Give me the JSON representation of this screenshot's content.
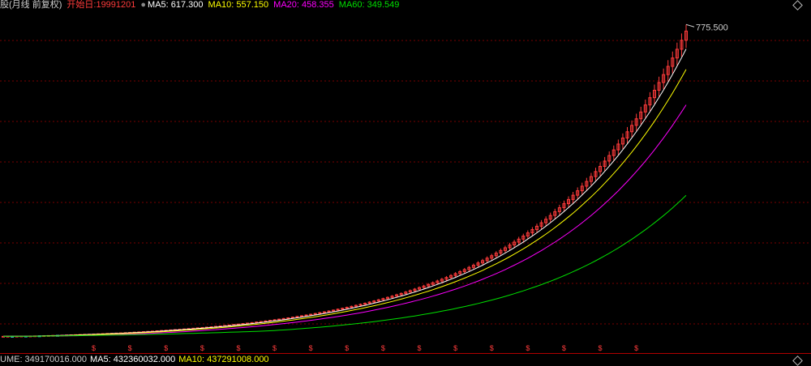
{
  "header": {
    "title_fragment": "股(月线 前复权)",
    "start_label": "开始日:19991201",
    "ma5": "MA5: 617.300",
    "ma10": "MA10: 557.150",
    "ma20": "MA20: 458.355",
    "ma60": "MA60: 349.549"
  },
  "volume_header": {
    "vol": "UME: 349170016.000",
    "ma5": "MA5: 432360032.000",
    "ma10": "MA10: 437291008.000"
  },
  "colors": {
    "up": "#ff3b3b",
    "down": "#54f0ff",
    "ma5": "#ffffff",
    "ma10": "#ffff00",
    "ma20": "#ff00ff",
    "ma60": "#00e000",
    "grid": "#7a0000",
    "text": "#cccccc"
  },
  "chart_data": {
    "type": "candlestick",
    "max_label": "775.500",
    "marker_glyph": "$",
    "dividend_markers": [
      5,
      7,
      9,
      11,
      13,
      15,
      17,
      19,
      21,
      23,
      25,
      27,
      29,
      31,
      33,
      35
    ],
    "ylim": [
      0,
      800
    ],
    "ohlc": [
      [
        5.0,
        5.6,
        4.8,
        5.3
      ],
      [
        5.3,
        5.8,
        5.1,
        5.5
      ],
      [
        5.5,
        6.0,
        5.2,
        5.4
      ],
      [
        5.4,
        5.9,
        5.2,
        5.7
      ],
      [
        5.7,
        6.2,
        5.5,
        6.0
      ],
      [
        6.0,
        6.4,
        5.7,
        5.8
      ],
      [
        5.8,
        6.3,
        5.6,
        6.1
      ],
      [
        6.1,
        6.7,
        5.9,
        6.5
      ],
      [
        6.5,
        7.0,
        6.2,
        6.4
      ],
      [
        6.4,
        7.1,
        6.3,
        6.9
      ],
      [
        6.9,
        7.4,
        6.6,
        7.2
      ],
      [
        7.2,
        7.8,
        7.0,
        7.6
      ],
      [
        7.6,
        8.1,
        7.3,
        7.5
      ],
      [
        7.5,
        8.3,
        7.4,
        8.1
      ],
      [
        8.1,
        8.8,
        7.9,
        8.6
      ],
      [
        8.6,
        9.2,
        8.3,
        8.9
      ],
      [
        8.9,
        9.6,
        8.7,
        9.3
      ],
      [
        9.3,
        10.1,
        9.1,
        9.8
      ],
      [
        9.8,
        10.5,
        9.4,
        10.2
      ],
      [
        10.2,
        11.0,
        9.9,
        10.6
      ],
      [
        10.6,
        11.4,
        10.3,
        11.0
      ],
      [
        11.0,
        11.9,
        10.7,
        11.5
      ],
      [
        11.5,
        12.3,
        11.1,
        11.9
      ],
      [
        11.9,
        12.8,
        11.6,
        12.4
      ],
      [
        12.4,
        13.2,
        12.0,
        12.8
      ],
      [
        12.8,
        13.7,
        12.5,
        13.3
      ],
      [
        13.3,
        14.2,
        12.9,
        13.8
      ],
      [
        13.8,
        14.8,
        13.4,
        14.3
      ],
      [
        14.3,
        15.3,
        13.9,
        14.9
      ],
      [
        14.9,
        16.0,
        14.5,
        15.6
      ],
      [
        15.6,
        16.6,
        15.1,
        16.2
      ],
      [
        16.2,
        17.3,
        15.8,
        16.9
      ],
      [
        16.9,
        18.0,
        16.4,
        17.5
      ],
      [
        17.5,
        18.7,
        17.0,
        18.3
      ],
      [
        18.3,
        19.5,
        17.8,
        19.0
      ],
      [
        19.0,
        20.3,
        18.5,
        19.7
      ],
      [
        19.7,
        20.9,
        19.2,
        20.4
      ],
      [
        20.4,
        21.8,
        19.9,
        21.2
      ],
      [
        21.2,
        22.6,
        20.7,
        22.0
      ],
      [
        22.0,
        23.3,
        21.4,
        22.7
      ],
      [
        22.7,
        24.2,
        22.1,
        23.5
      ],
      [
        23.5,
        25.0,
        22.9,
        24.4
      ],
      [
        24.4,
        26.0,
        23.8,
        25.3
      ],
      [
        25.3,
        27.0,
        24.6,
        26.2
      ],
      [
        26.2,
        27.9,
        25.5,
        27.1
      ],
      [
        27.1,
        28.9,
        26.4,
        28.0
      ],
      [
        28.0,
        29.8,
        27.3,
        29.0
      ],
      [
        29.0,
        30.9,
        28.3,
        30.0
      ],
      [
        30.0,
        31.9,
        29.2,
        31.0
      ],
      [
        31.0,
        33.0,
        30.2,
        32.1
      ],
      [
        32.1,
        34.2,
        31.3,
        33.2
      ],
      [
        33.2,
        35.3,
        32.3,
        34.4
      ],
      [
        34.4,
        36.6,
        33.5,
        35.5
      ],
      [
        35.5,
        37.8,
        34.6,
        36.8
      ],
      [
        36.8,
        39.0,
        35.8,
        38.0
      ],
      [
        38.0,
        40.4,
        37.0,
        39.2
      ],
      [
        39.2,
        41.7,
        38.2,
        40.6
      ],
      [
        40.6,
        43.1,
        39.5,
        41.9
      ],
      [
        41.9,
        44.5,
        40.8,
        43.3
      ],
      [
        43.3,
        46.0,
        42.2,
        44.8
      ],
      [
        44.8,
        47.5,
        43.6,
        46.2
      ],
      [
        46.2,
        49.0,
        45.0,
        47.8
      ],
      [
        47.8,
        50.6,
        46.5,
        49.3
      ],
      [
        49.3,
        52.2,
        48.0,
        51.0
      ],
      [
        51.0,
        54.0,
        49.6,
        52.6
      ],
      [
        52.6,
        55.7,
        51.2,
        54.3
      ],
      [
        54.3,
        57.5,
        52.9,
        56.1
      ],
      [
        56.1,
        59.3,
        54.6,
        57.9
      ],
      [
        57.9,
        61.2,
        56.4,
        59.8
      ],
      [
        59.8,
        63.2,
        58.2,
        61.7
      ],
      [
        61.7,
        65.3,
        60.1,
        63.7
      ],
      [
        63.7,
        67.3,
        62.0,
        65.7
      ],
      [
        65.7,
        69.5,
        64.0,
        67.8
      ],
      [
        67.8,
        71.7,
        66.1,
        70.0
      ],
      [
        70.0,
        74.0,
        68.1,
        72.3
      ],
      [
        72.3,
        76.3,
        70.4,
        74.5
      ],
      [
        74.5,
        78.7,
        72.6,
        76.9
      ],
      [
        76.9,
        81.2,
        74.9,
        79.3
      ],
      [
        79.3,
        83.8,
        77.2,
        81.8
      ],
      [
        81.8,
        86.4,
        79.7,
        84.4
      ],
      [
        84.4,
        89.1,
        82.2,
        87.0
      ],
      [
        87.0,
        91.9,
        84.8,
        89.8
      ],
      [
        89.8,
        94.7,
        87.5,
        92.6
      ],
      [
        92.6,
        97.7,
        90.2,
        95.5
      ],
      [
        95.5,
        100.7,
        93.0,
        98.4
      ],
      [
        98.4,
        103.8,
        95.9,
        101.5
      ],
      [
        101.5,
        107.1,
        98.9,
        104.6
      ],
      [
        104.6,
        110.4,
        101.9,
        107.9
      ],
      [
        107.9,
        113.8,
        105.1,
        111.2
      ],
      [
        111.2,
        117.3,
        108.4,
        114.7
      ],
      [
        114.7,
        121.0,
        111.7,
        118.2
      ],
      [
        118.2,
        124.7,
        115.2,
        121.9
      ],
      [
        121.9,
        128.6,
        118.7,
        125.6
      ],
      [
        125.6,
        132.5,
        122.4,
        129.5
      ],
      [
        129.5,
        136.6,
        126.2,
        133.5
      ],
      [
        133.5,
        140.8,
        130.1,
        137.6
      ],
      [
        137.6,
        145.2,
        134.1,
        141.9
      ],
      [
        141.9,
        149.6,
        138.2,
        146.2
      ],
      [
        146.2,
        154.2,
        142.5,
        150.7
      ],
      [
        150.7,
        158.9,
        146.9,
        155.4
      ],
      [
        155.4,
        163.9,
        151.4,
        160.2
      ],
      [
        160.2,
        168.9,
        156.1,
        165.1
      ],
      [
        165.1,
        174.1,
        160.9,
        170.2
      ],
      [
        170.2,
        179.5,
        165.9,
        175.5
      ],
      [
        175.5,
        185.1,
        171.0,
        180.9
      ],
      [
        180.9,
        190.8,
        176.3,
        186.5
      ],
      [
        186.5,
        196.7,
        181.7,
        192.3
      ],
      [
        192.3,
        202.8,
        187.4,
        198.3
      ],
      [
        198.3,
        209.1,
        193.2,
        204.4
      ],
      [
        204.4,
        215.6,
        199.2,
        210.7
      ],
      [
        210.7,
        222.2,
        205.3,
        217.3
      ],
      [
        217.3,
        229.1,
        211.7,
        224.0
      ],
      [
        224.0,
        236.2,
        218.3,
        230.9
      ],
      [
        230.9,
        243.5,
        225.0,
        238.0
      ],
      [
        238.0,
        251.1,
        231.9,
        245.4
      ],
      [
        245.4,
        258.8,
        239.1,
        253.0
      ],
      [
        253.0,
        266.9,
        246.5,
        260.8
      ],
      [
        260.8,
        275.1,
        254.2,
        268.9
      ],
      [
        268.9,
        283.6,
        262.0,
        277.2
      ],
      [
        277.2,
        292.4,
        270.1,
        285.8
      ],
      [
        285.8,
        301.5,
        278.5,
        294.6
      ],
      [
        294.6,
        310.8,
        287.1,
        303.8
      ],
      [
        303.8,
        320.4,
        296.0,
        313.2
      ],
      [
        313.2,
        330.3,
        305.2,
        322.9
      ],
      [
        322.9,
        340.6,
        314.6,
        332.9
      ],
      [
        332.9,
        351.1,
        324.4,
        343.2
      ],
      [
        343.2,
        362.0,
        334.4,
        353.8
      ],
      [
        353.8,
        373.2,
        344.8,
        364.8
      ],
      [
        364.8,
        384.8,
        355.5,
        376.1
      ],
      [
        376.1,
        396.7,
        366.5,
        387.8
      ],
      [
        387.8,
        409.0,
        377.9,
        399.8
      ],
      [
        399.8,
        421.7,
        389.6,
        412.2
      ],
      [
        412.2,
        434.8,
        401.7,
        425.0
      ],
      [
        425.0,
        448.2,
        414.2,
        438.2
      ],
      [
        438.2,
        462.1,
        427.0,
        451.8
      ],
      [
        451.8,
        476.5,
        440.3,
        465.8
      ],
      [
        465.8,
        491.3,
        453.9,
        480.2
      ],
      [
        480.2,
        506.5,
        468.0,
        495.1
      ],
      [
        495.1,
        522.2,
        482.5,
        510.5
      ],
      [
        510.5,
        538.4,
        497.5,
        526.3
      ],
      [
        526.3,
        555.1,
        512.9,
        542.6
      ],
      [
        542.6,
        572.3,
        528.8,
        559.4
      ],
      [
        559.4,
        590.0,
        545.2,
        576.8
      ],
      [
        576.8,
        608.3,
        562.1,
        594.7
      ],
      [
        594.7,
        627.2,
        579.5,
        613.1
      ],
      [
        613.1,
        646.6,
        597.5,
        632.1
      ],
      [
        632.1,
        666.7,
        616.0,
        651.7
      ],
      [
        651.7,
        687.4,
        635.1,
        672.0
      ],
      [
        672.0,
        708.7,
        654.8,
        692.8
      ],
      [
        692.8,
        730.7,
        675.1,
        714.3
      ],
      [
        714.3,
        753.3,
        696.1,
        736.5
      ],
      [
        736.5,
        775.5,
        717.7,
        759.3
      ]
    ]
  }
}
